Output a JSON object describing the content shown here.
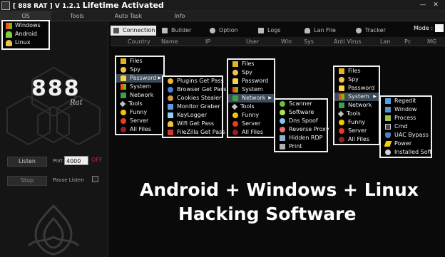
{
  "titlebar": {
    "prefix": "[ 888 RAT ] V 1.2.1",
    "edition": "Lifetime Activated",
    "minimize": "—",
    "close": "✕"
  },
  "menubar": {
    "os": "OS",
    "tools": "Tools",
    "autotask": "Auto Task",
    "info": "Info"
  },
  "os_menu": [
    {
      "label": "Windows",
      "icon": "windows-icon"
    },
    {
      "label": "Android",
      "icon": "android-icon"
    },
    {
      "label": "Linux",
      "icon": "linux-icon"
    }
  ],
  "left_panel": {
    "logo": "888",
    "logo_sub": "Rat",
    "listen_label": "Listen",
    "stop_label": "Stop",
    "port_label": "Port",
    "port_value": "4000",
    "status": "OFF",
    "pause_label": "Pause Listen"
  },
  "tabs": [
    "Connection",
    "Builder",
    "Option",
    "Logs",
    "Lan Flie",
    "Tracker"
  ],
  "mode_label": "Mode :",
  "columns": [
    "Country",
    "Name",
    "IP",
    "User",
    "Win",
    "Sys",
    "Anti Virus",
    "Lan",
    "Pc",
    "MG"
  ],
  "menu1": {
    "main": [
      {
        "label": "Files",
        "icon": "folder-icon"
      },
      {
        "label": "Spy",
        "icon": "eye-icon"
      },
      {
        "label": "Password",
        "icon": "lock-icon",
        "selected": true,
        "submenu": true
      },
      {
        "label": "System",
        "icon": "windows-icon"
      },
      {
        "label": "Network",
        "icon": "network-icon"
      },
      {
        "label": "Tools",
        "icon": "tools-icon"
      },
      {
        "label": "Funny",
        "icon": "smiley-icon"
      },
      {
        "label": "Server",
        "icon": "server-icon"
      },
      {
        "label": "All Files",
        "icon": "all-files-icon"
      }
    ],
    "sub": [
      {
        "label": "Plugins Get Pass",
        "icon": "key-icon"
      },
      {
        "label": "Browser Get Pass",
        "icon": "globe-icon"
      },
      {
        "label": "Cookies Stealer",
        "icon": "cookie-icon"
      },
      {
        "label": "Monitor Graber",
        "icon": "monitor-icon"
      },
      {
        "label": "KeyLogger",
        "icon": "keyboard-icon"
      },
      {
        "label": "Wifi Get Pass",
        "icon": "wifi-icon"
      },
      {
        "label": "FileZilla Get Pass",
        "icon": "filezilla-icon"
      }
    ]
  },
  "menu2": {
    "main": [
      {
        "label": "Files",
        "icon": "folder-icon"
      },
      {
        "label": "Spy",
        "icon": "eye-icon"
      },
      {
        "label": "Password",
        "icon": "lock-icon"
      },
      {
        "label": "System",
        "icon": "windows-icon"
      },
      {
        "label": "Network",
        "icon": "network-icon",
        "selected": true,
        "submenu": true
      },
      {
        "label": "Tools",
        "icon": "tools-icon"
      },
      {
        "label": "Funny",
        "icon": "smiley-icon"
      },
      {
        "label": "Server",
        "icon": "server-icon"
      },
      {
        "label": "All Files",
        "icon": "all-files-icon"
      }
    ],
    "sub": [
      {
        "label": "Scanner",
        "icon": "scanner-icon"
      },
      {
        "label": "Software",
        "icon": "software-icon"
      },
      {
        "label": "Dns Spoof",
        "icon": "dns-icon"
      },
      {
        "label": "Reverse Proxy",
        "icon": "proxy-icon"
      },
      {
        "label": "Hidden RDP",
        "icon": "rdp-icon"
      },
      {
        "label": "Print",
        "icon": "printer-icon"
      }
    ]
  },
  "menu3": {
    "main": [
      {
        "label": "Files",
        "icon": "folder-icon"
      },
      {
        "label": "Spy",
        "icon": "eye-icon"
      },
      {
        "label": "Password",
        "icon": "lock-icon"
      },
      {
        "label": "System",
        "icon": "windows-icon",
        "selected": true,
        "submenu": true
      },
      {
        "label": "Network",
        "icon": "network-icon"
      },
      {
        "label": "Tools",
        "icon": "tools-icon"
      },
      {
        "label": "Funny",
        "icon": "smiley-icon"
      },
      {
        "label": "Server",
        "icon": "server-icon"
      },
      {
        "label": "All Files",
        "icon": "all-files-icon"
      }
    ],
    "sub": [
      {
        "label": "Regedit",
        "icon": "regedit-icon"
      },
      {
        "label": "Window",
        "icon": "window-icon"
      },
      {
        "label": "Process",
        "icon": "process-icon"
      },
      {
        "label": "Cmd",
        "icon": "cmd-icon"
      },
      {
        "label": "UAC Bypass",
        "icon": "shield-icon"
      },
      {
        "label": "Power",
        "icon": "power-icon"
      },
      {
        "label": "Installed Soft",
        "icon": "installed-icon"
      }
    ]
  },
  "overlay": {
    "line1": "Android + Windows + Linux",
    "line2": "Hacking Software"
  },
  "colors": {
    "accent_selected": "#3c4b59",
    "status_off": "#dd2222",
    "background": "#0c0c0c"
  }
}
